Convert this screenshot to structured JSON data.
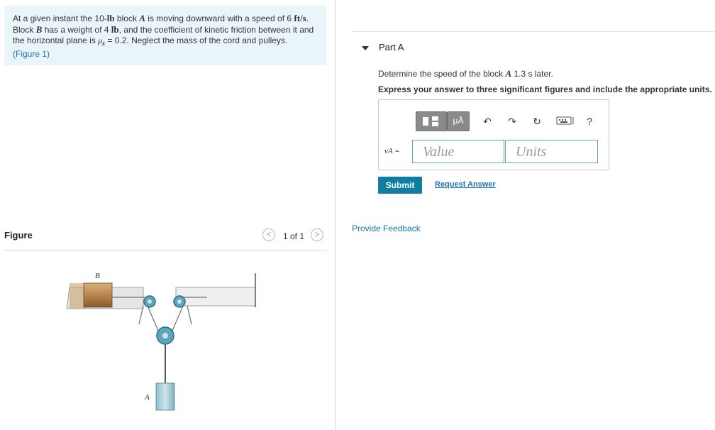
{
  "problem": {
    "p1": "At a given instant the 10-",
    "p2": "lb",
    "p3": " block ",
    "p4": "A",
    "p5": " is moving downward with a speed of 6 ",
    "p6": "ft/s",
    "p7": ".",
    "p8": "Block ",
    "p9": "B",
    "p10": " has a weight of 4 ",
    "p11": "lb",
    "p12": ", and the coefficient of kinetic friction between it and",
    "p13": "the horizontal plane is ",
    "p14": "μ",
    "p15": "k",
    "p16": " = 0.2. Neglect the mass of the cord and pulleys.",
    "figure_link": "(Figure 1)"
  },
  "figure": {
    "title": "Figure",
    "counter": "1 of 1",
    "prev_label": "<",
    "next_label": ">",
    "label_b": "B",
    "label_a": "A"
  },
  "part": {
    "title": "Part A",
    "q1": "Determine the speed of the block ",
    "q2": "A",
    "q3": " 1.3  s later.",
    "instruction": "Express your answer to three significant figures and include the appropriate units."
  },
  "answer": {
    "toolbar": {
      "units_label": "μÅ",
      "undo_icon": "undo-icon",
      "redo_icon": "redo-icon",
      "reset_icon": "reset-icon",
      "keyboard_icon": "keyboard-icon",
      "help_label": "?"
    },
    "var_label": "vA =",
    "value_placeholder": "Value",
    "units_placeholder": "Units"
  },
  "actions": {
    "submit": "Submit",
    "request": "Request Answer",
    "feedback": "Provide Feedback"
  },
  "colors": {
    "problem_bg": "#eaf5f9",
    "link": "#1a73b3",
    "submit_bg": "#0e7fa3",
    "field_border": "#6ba3b6"
  }
}
